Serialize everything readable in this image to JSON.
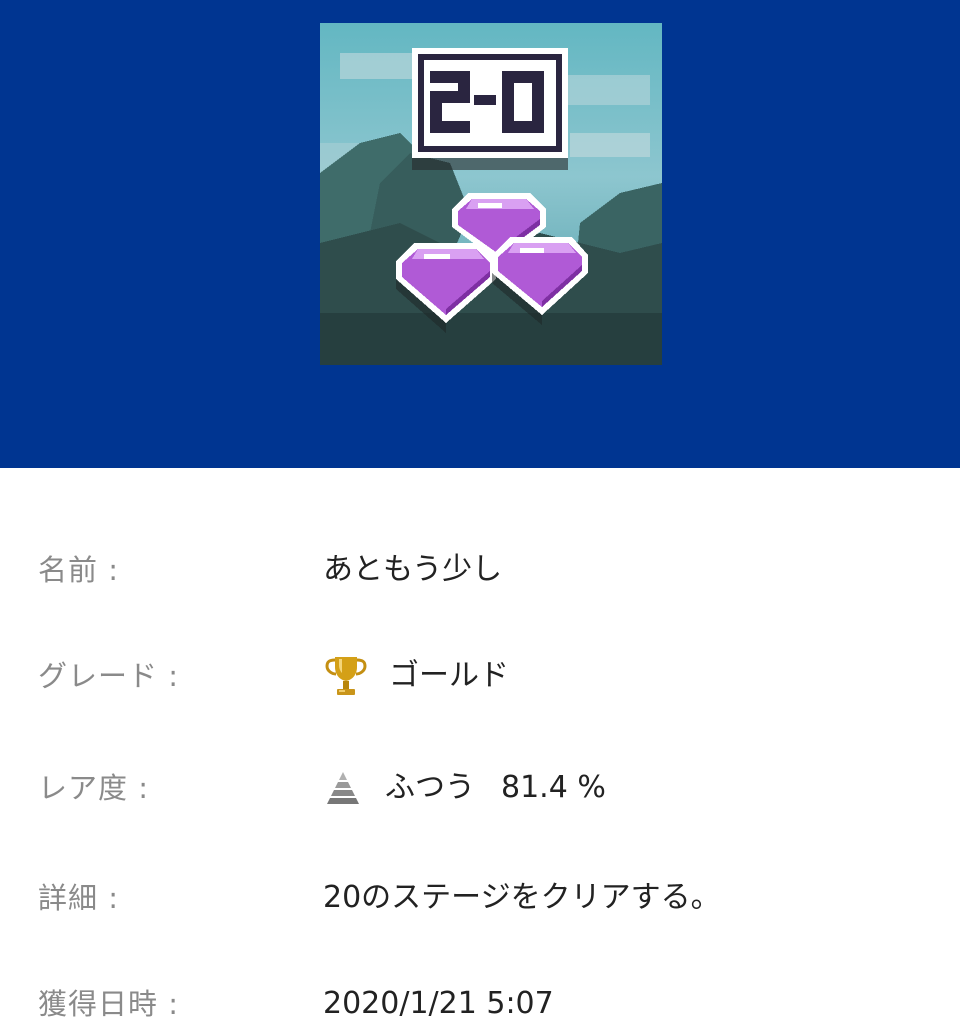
{
  "achievement": {
    "badge_text": "2-0",
    "rows": [
      {
        "label": "名前 :",
        "value": "あともう少し"
      },
      {
        "label": "グレード :",
        "value": "ゴールド",
        "icon": "trophy-icon"
      },
      {
        "label": "レア度 :",
        "value": "ふつう",
        "percent": "81.4 %",
        "icon": "rarity-pyramid-icon"
      },
      {
        "label": "詳細 :",
        "value": "20のステージをクリアする。"
      },
      {
        "label": "獲得日時 :",
        "value": "2020/1/21 5:07"
      }
    ]
  },
  "colors": {
    "header_bg": "#003591",
    "label": "#8a8a8a",
    "value": "#222222",
    "gem": "#b05ad6",
    "trophy": "#d4a017"
  }
}
